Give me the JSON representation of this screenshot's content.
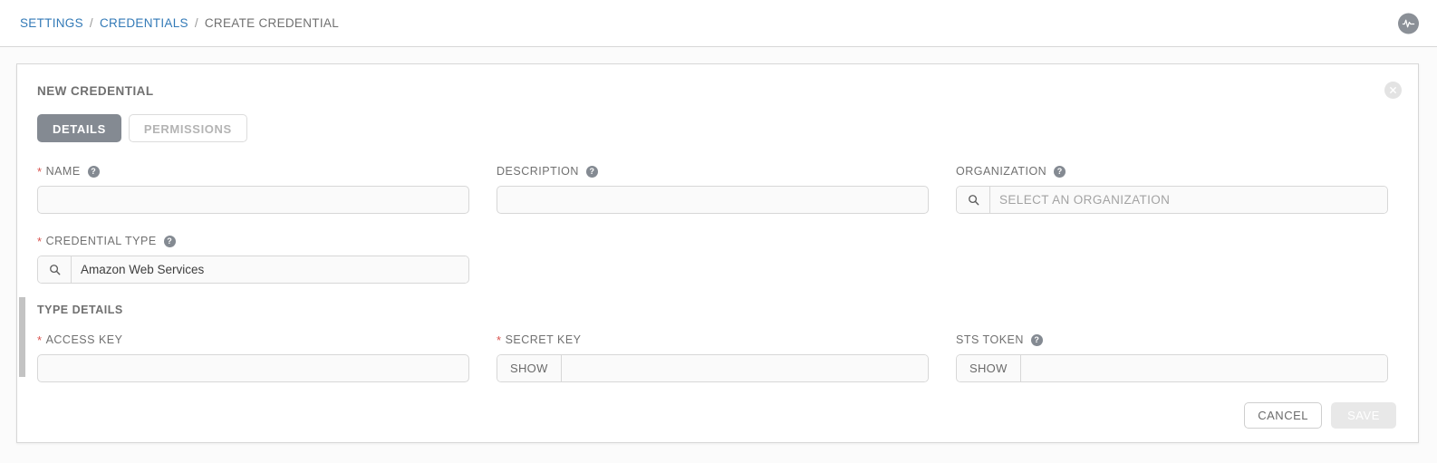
{
  "breadcrumb": {
    "items": [
      {
        "label": "SETTINGS",
        "link": true
      },
      {
        "label": "CREDENTIALS",
        "link": true
      },
      {
        "label": "CREATE CREDENTIAL",
        "link": false
      }
    ],
    "separator": "/"
  },
  "topbar": {
    "activity_icon": "activity-stream-icon"
  },
  "card": {
    "title": "NEW CREDENTIAL",
    "close_icon": "close-icon"
  },
  "tabs": [
    {
      "label": "DETAILS",
      "active": true
    },
    {
      "label": "PERMISSIONS",
      "active": false
    }
  ],
  "fields": {
    "name": {
      "label": "NAME",
      "required": true,
      "has_help": true,
      "value": "",
      "placeholder": ""
    },
    "description": {
      "label": "DESCRIPTION",
      "required": false,
      "has_help": true,
      "value": "",
      "placeholder": ""
    },
    "organization": {
      "label": "ORGANIZATION",
      "required": false,
      "has_help": true,
      "value": "",
      "placeholder": "SELECT AN ORGANIZATION",
      "prefix_icon": "search-icon"
    },
    "credential_type": {
      "label": "CREDENTIAL TYPE",
      "required": true,
      "has_help": true,
      "value": "Amazon Web Services",
      "placeholder": "",
      "prefix_icon": "search-icon"
    },
    "access_key": {
      "label": "ACCESS KEY",
      "required": true,
      "has_help": false,
      "value": "",
      "placeholder": ""
    },
    "secret_key": {
      "label": "SECRET KEY",
      "required": true,
      "has_help": false,
      "value": "",
      "placeholder": "",
      "prefix_label": "SHOW"
    },
    "sts_token": {
      "label": "STS TOKEN",
      "required": false,
      "has_help": true,
      "value": "",
      "placeholder": "",
      "prefix_label": "SHOW"
    }
  },
  "sections": {
    "type_details": "TYPE DETAILS"
  },
  "buttons": {
    "cancel": "CANCEL",
    "save": "SAVE"
  },
  "symbols": {
    "required_marker": "*",
    "help_glyph": "?",
    "close_glyph": "✕"
  },
  "colors": {
    "link": "#337ab7",
    "required": "#d9534f",
    "tab_active_bg": "#848a92",
    "help_icon_bg": "#848a92",
    "page_bg": "#fbfbfb",
    "border": "#d7d7d7"
  }
}
